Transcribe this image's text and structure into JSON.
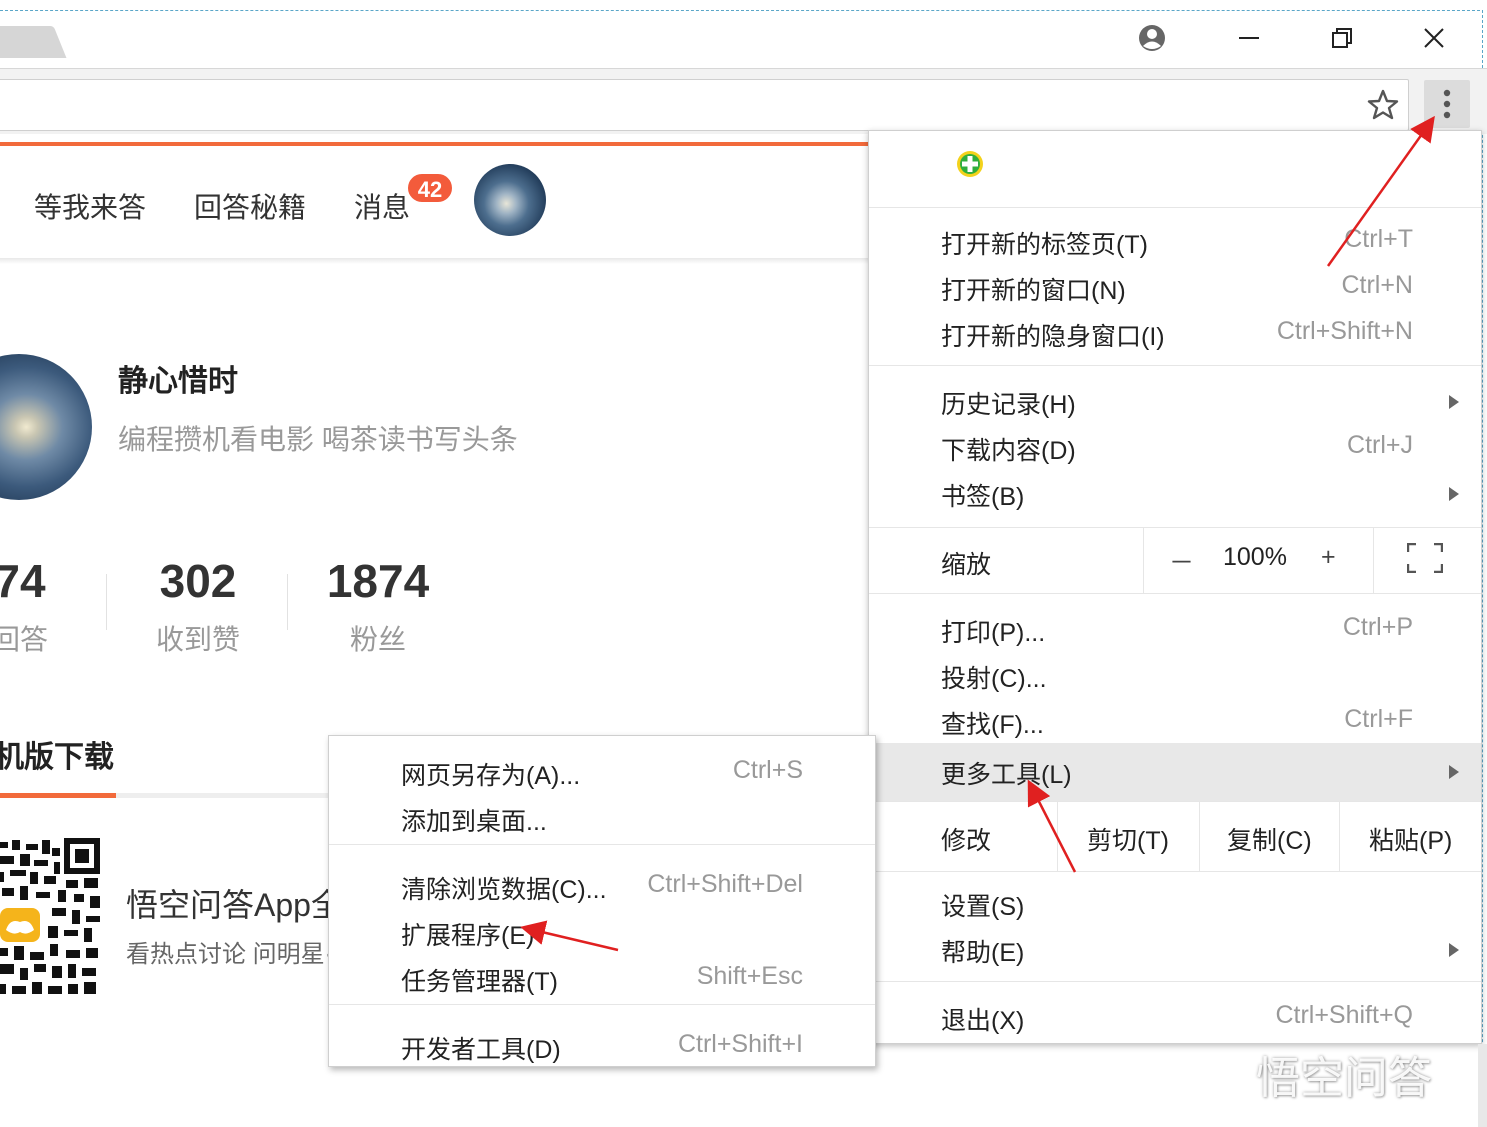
{
  "window": {
    "profile_icon": "account-circle-icon",
    "minimize_icon": "minimize-icon",
    "restore_icon": "restore-icon",
    "close_icon": "close-icon"
  },
  "toolbar": {
    "bookmark_icon": "star-icon",
    "menu_icon": "vertical-dots-icon"
  },
  "page": {
    "nav": [
      "等我来答",
      "回答秘籍",
      "消息"
    ],
    "message_badge": "42",
    "profile": {
      "name": "静心惜时",
      "bio": "编程攒机看电影 喝茶读书写头条"
    },
    "stats": [
      {
        "value": "74",
        "label": "回答"
      },
      {
        "value": "302",
        "label": "收到赞"
      },
      {
        "value": "1874",
        "label": "粉丝"
      }
    ],
    "download_title": "机版下载",
    "app_title": "悟空问答App全",
    "app_desc": "看热点讨论 问明星·"
  },
  "main_menu": {
    "extension_icon": "green-plus-extension-icon",
    "groups": {
      "new": [
        {
          "label": "打开新的标签页(T)",
          "shortcut": "Ctrl+T"
        },
        {
          "label": "打开新的窗口(N)",
          "shortcut": "Ctrl+N"
        },
        {
          "label": "打开新的隐身窗口(I)",
          "shortcut": "Ctrl+Shift+N"
        }
      ],
      "history": [
        {
          "label": "历史记录(H)",
          "shortcut": ""
        },
        {
          "label": "下载内容(D)",
          "shortcut": "Ctrl+J"
        },
        {
          "label": "书签(B)",
          "shortcut": ""
        }
      ],
      "print": [
        {
          "label": "打印(P)...",
          "shortcut": "Ctrl+P"
        },
        {
          "label": "投射(C)...",
          "shortcut": ""
        },
        {
          "label": "查找(F)...",
          "shortcut": "Ctrl+F"
        },
        {
          "label": "更多工具(L)",
          "shortcut": ""
        }
      ],
      "settings": [
        {
          "label": "设置(S)",
          "shortcut": ""
        },
        {
          "label": "帮助(E)",
          "shortcut": ""
        }
      ],
      "exit": {
        "label": "退出(X)",
        "shortcut": "Ctrl+Shift+Q"
      }
    },
    "zoom": {
      "label": "缩放",
      "minus": "－",
      "value": "100%",
      "plus": "+",
      "fullscreen_icon": "fullscreen-icon"
    },
    "edit": {
      "label": "修改",
      "cut": "剪切(T)",
      "copy": "复制(C)",
      "paste": "粘贴(P)"
    }
  },
  "sub_menu": {
    "items": [
      {
        "label": "网页另存为(A)...",
        "shortcut": "Ctrl+S"
      },
      {
        "label": "添加到桌面...",
        "shortcut": ""
      },
      {
        "label": "清除浏览数据(C)...",
        "shortcut": "Ctrl+Shift+Del"
      },
      {
        "label": "扩展程序(E)",
        "shortcut": ""
      },
      {
        "label": "任务管理器(T)",
        "shortcut": "Shift+Esc"
      },
      {
        "label": "开发者工具(D)",
        "shortcut": "Ctrl+Shift+I"
      }
    ]
  },
  "watermark": "悟空问答",
  "colors": {
    "accent": "#f26a3b",
    "badge": "#f35b3b",
    "arrow": "#e02020"
  }
}
